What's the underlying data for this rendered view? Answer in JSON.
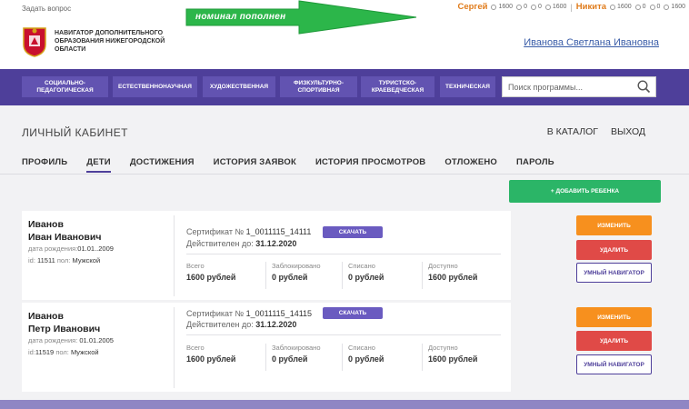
{
  "topbar": {
    "ask_link": "Задать вопрос",
    "users": [
      {
        "name": "Сергей",
        "stats": [
          "1600",
          "0",
          "0",
          "1600"
        ]
      },
      {
        "name": "Никита",
        "stats": [
          "1600",
          "0",
          "0",
          "1600"
        ]
      }
    ]
  },
  "annotation": {
    "text": "номинал пополнен",
    "color": "#2cb64a"
  },
  "header": {
    "org_name": "НАВИГАТОР ДОПОЛНИТЕЛЬНОГО ОБРАЗОВАНИЯ НИЖЕГОРОДСКОЙ ОБЛАСТИ",
    "user_name": "Иванова Светлана Ивановна"
  },
  "nav": {
    "categories": [
      "СОЦИАЛЬНО-ПЕДАГОГИЧЕСКАЯ",
      "ЕСТЕСТВЕННОНАУЧНАЯ",
      "ХУДОЖЕСТВЕННАЯ",
      "ФИЗКУЛЬТУРНО-СПОРТИВНАЯ",
      "ТУРИСТСКО-КРАЕВЕДЧЕСКАЯ",
      "ТЕХНИЧЕСКАЯ"
    ],
    "search_placeholder": "Поиск программы..."
  },
  "main": {
    "title": "ЛИЧНЫЙ КАБИНЕТ",
    "catalog_link": "В КАТАЛОГ",
    "logout_link": "ВЫХОД",
    "tabs": [
      "ПРОФИЛЬ",
      "ДЕТИ",
      "ДОСТИЖЕНИЯ",
      "ИСТОРИЯ ЗАЯВОК",
      "ИСТОРИЯ ПРОСМОТРОВ",
      "ОТЛОЖЕНО",
      "ПАРОЛЬ"
    ],
    "active_tab": "ДЕТИ",
    "add_child_button": "+ ДОБАВИТЬ РЕБЕНКА"
  },
  "children": [
    {
      "last_name": "Иванов",
      "first_names": "Иван Иванович",
      "birth_label": "дата рождения:",
      "birth_date": "01.01..2009",
      "id_label": "id:",
      "id": "11511",
      "sex_label": "пол:",
      "sex": "Мужской",
      "cert_label": "Сертификат №",
      "cert_number": "1_0011115_14111",
      "download_label": "СКАЧАТЬ",
      "valid_label": "Действителен до:",
      "valid_until": "31.12.2020",
      "balances": [
        {
          "label": "Всего",
          "value": "1600 рублей"
        },
        {
          "label": "Заблокировано",
          "value": "0 рублей"
        },
        {
          "label": "Списано",
          "value": "0 рублей"
        },
        {
          "label": "Доступно",
          "value": "1600 рублей"
        }
      ],
      "actions": {
        "edit": "ИЗМЕНИТЬ",
        "delete": "УДАЛИТЬ",
        "smart": "УМНЫЙ НАВИГАТОР"
      }
    },
    {
      "last_name": "Иванов",
      "first_names": "Петр Иванович",
      "birth_label": "дата рождения:",
      "birth_date": "01.01.2005",
      "id_label": "id:",
      "id": "11519",
      "sex_label": "пол:",
      "sex": "Мужской",
      "cert_label": "Сертификат №",
      "cert_number": "1_0011115_14115",
      "download_label": "СКАЧАТЬ",
      "valid_label": "Действителен до:",
      "valid_until": "31.12.2020",
      "balances": [
        {
          "label": "Всего",
          "value": "1600 рублей"
        },
        {
          "label": "Заблокировано",
          "value": "0 рублей"
        },
        {
          "label": "Списано",
          "value": "0 рублей"
        },
        {
          "label": "Доступно",
          "value": "1600 рублей"
        }
      ],
      "actions": {
        "edit": "ИЗМЕНИТЬ",
        "delete": "УДАЛИТЬ",
        "smart": "УМНЫЙ НАВИГАТОР"
      }
    }
  ],
  "colors": {
    "brand": "#4e3f9a",
    "accent_orange": "#f7901e",
    "danger": "#e04a47",
    "success": "#2bb567"
  }
}
